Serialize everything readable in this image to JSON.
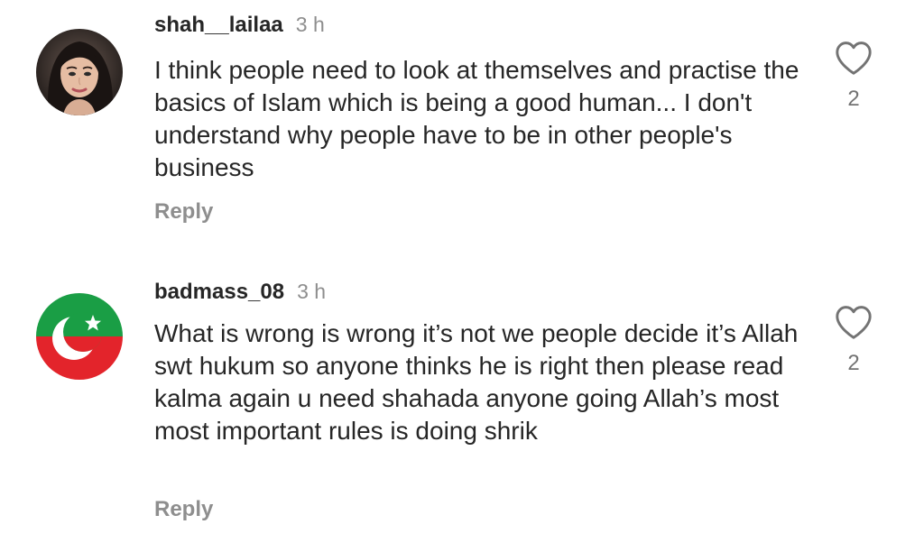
{
  "comments": [
    {
      "username": "shah__lailaa",
      "time": "3 h",
      "text": "I think people need to look at themselves and practise the basics of Islam which is being a good human... I don't understand why people have to be in other people's business",
      "reply_label": "Reply",
      "likes": "2",
      "avatar": "profile-photo"
    },
    {
      "username": "badmass_08",
      "time": "3 h",
      "text": "What is wrong is wrong it’s not we people decide it’s Allah swt hukum so anyone thinks he is right then please read kalma again u need shahada anyone going Allah’s most most important rules is doing shrik",
      "reply_label": "Reply",
      "likes": "2",
      "avatar": "flag-crescent-star"
    }
  ],
  "icons": {
    "like": "heart-outline-icon"
  },
  "colors": {
    "username": "#262626",
    "muted": "#8e8e8e",
    "flag_green": "#1a9e45",
    "flag_red": "#e3242b"
  }
}
